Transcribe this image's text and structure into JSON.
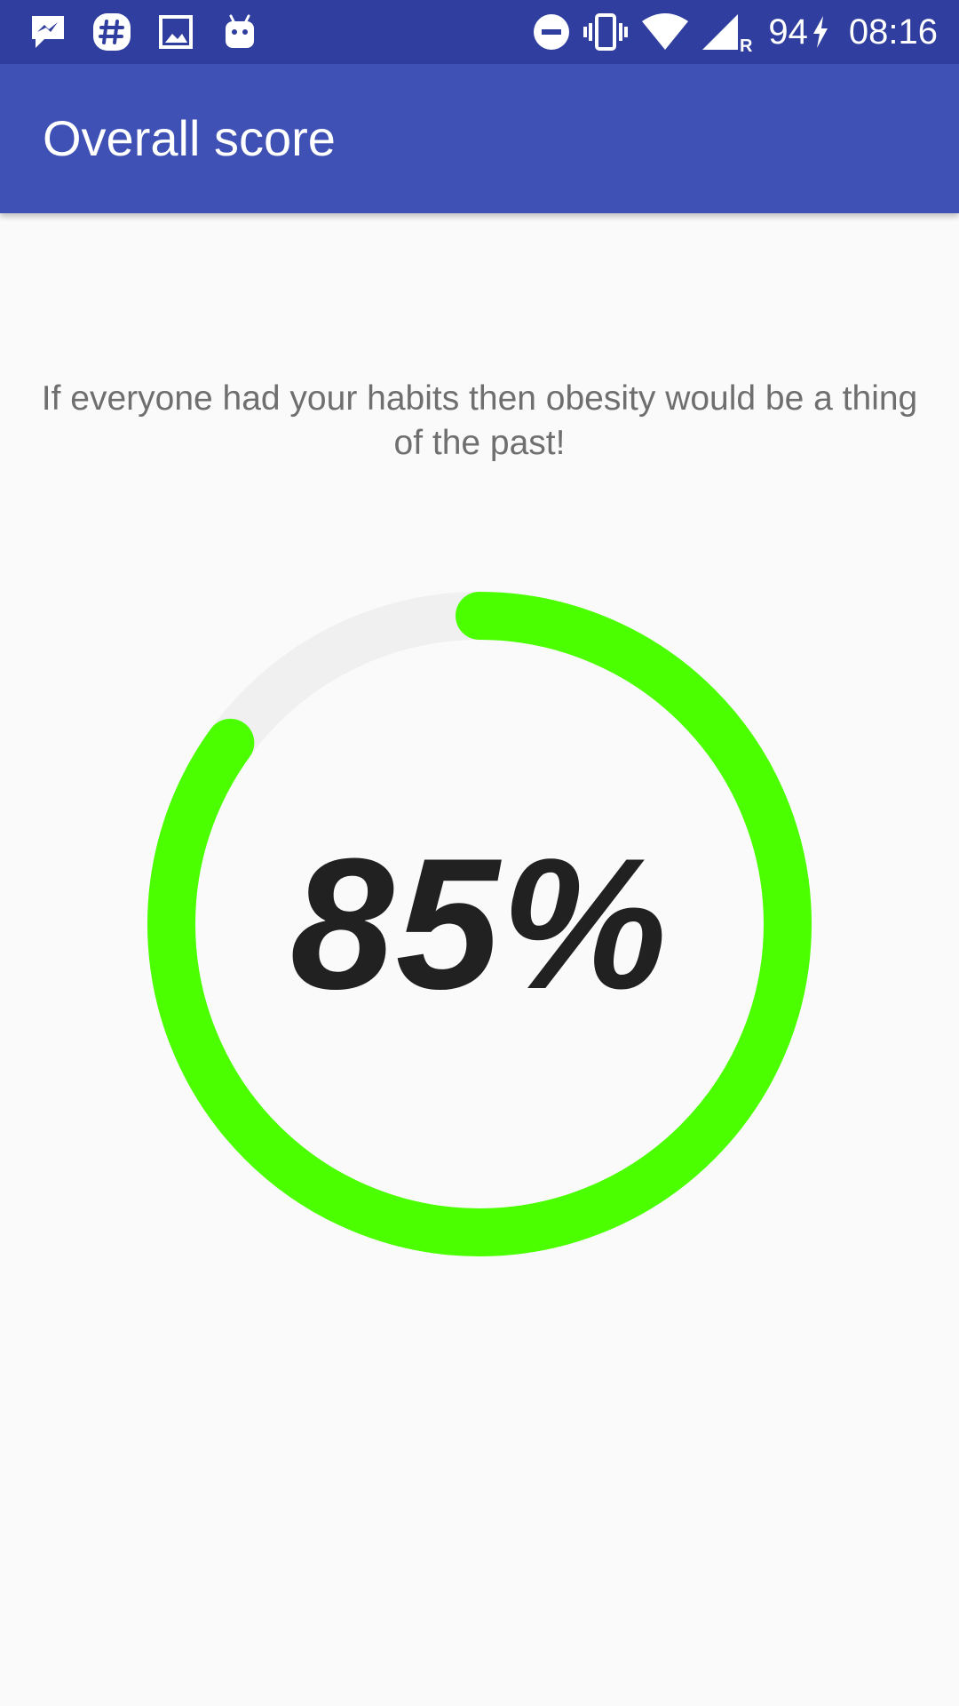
{
  "status_bar": {
    "notification_icons": [
      "messenger-icon",
      "slack-icon",
      "gallery-icon",
      "android-icon"
    ],
    "system_icons": [
      "do-not-disturb-icon",
      "vibrate-icon",
      "wifi-icon",
      "signal-icon",
      "battery-charging-icon"
    ],
    "signal_roaming": "R",
    "battery": "94",
    "time": "08:16"
  },
  "app_bar": {
    "title": "Overall score"
  },
  "message": "If everyone had your habits then obesity would be a thing of the past!",
  "score": {
    "label": "85%",
    "fraction": 0.85,
    "progress_color": "#4cff00",
    "track_color": "#f0f0f0"
  }
}
